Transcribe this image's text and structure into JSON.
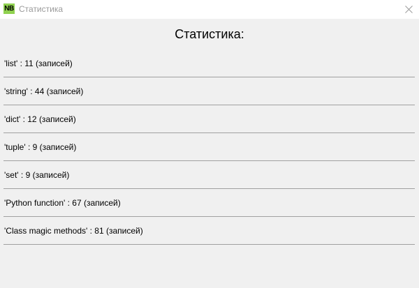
{
  "window": {
    "icon_text": "NB",
    "title": "Статистика"
  },
  "heading": "Статистика:",
  "rows": [
    "'list' : 11 (записей)",
    "'string' : 44 (записей)",
    "'dict' : 12 (записей)",
    "'tuple' : 9 (записей)",
    "'set' : 9 (записей)",
    "'Python function' : 67 (записей)",
    "'Class magic methods' : 81 (записей)"
  ],
  "icons": {
    "close": "close-icon",
    "app": "app-icon"
  },
  "colors": {
    "app_icon_bg": "#8fd14f",
    "title_text": "#9a9a9a",
    "separator": "#a0a0a0",
    "background": "#f0f0f0"
  }
}
